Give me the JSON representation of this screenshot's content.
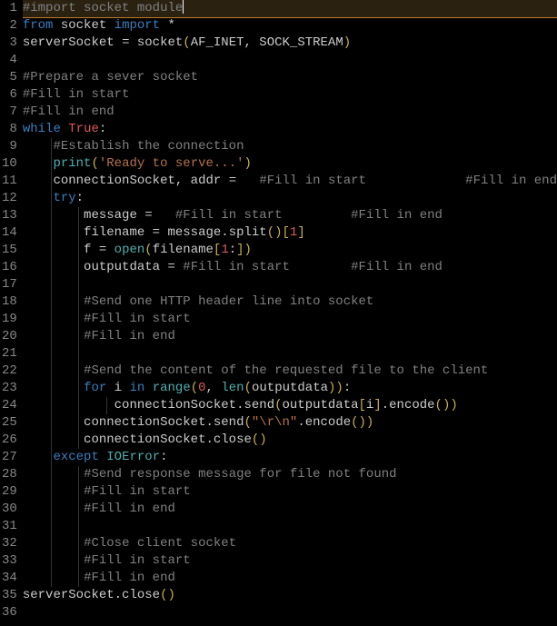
{
  "lines": [
    {
      "n": "1",
      "tokens": [
        {
          "t": "#import socket module",
          "c": "cm"
        }
      ],
      "hl": true,
      "cursor": true
    },
    {
      "n": "2",
      "tokens": [
        {
          "t": "from",
          "c": "kw"
        },
        {
          "t": " socket ",
          "c": "id"
        },
        {
          "t": "import",
          "c": "kw"
        },
        {
          "t": " *",
          "c": "op"
        }
      ]
    },
    {
      "n": "3",
      "tokens": [
        {
          "t": "serverSocket ",
          "c": "id"
        },
        {
          "t": "=",
          "c": "eq"
        },
        {
          "t": " socket",
          "c": "id"
        },
        {
          "t": "(",
          "c": "paren"
        },
        {
          "t": "AF_INET",
          "c": "id"
        },
        {
          "t": ",",
          "c": "punc"
        },
        {
          "t": " SOCK_STREAM",
          "c": "id"
        },
        {
          "t": ")",
          "c": "paren"
        }
      ]
    },
    {
      "n": "4",
      "tokens": []
    },
    {
      "n": "5",
      "tokens": [
        {
          "t": "#Prepare a sever socket",
          "c": "cm"
        }
      ]
    },
    {
      "n": "6",
      "tokens": [
        {
          "t": "#Fill in start",
          "c": "cm"
        }
      ]
    },
    {
      "n": "7",
      "tokens": [
        {
          "t": "#Fill in end",
          "c": "cm"
        }
      ]
    },
    {
      "n": "8",
      "tokens": [
        {
          "t": "while",
          "c": "kw"
        },
        {
          "t": " ",
          "c": "id"
        },
        {
          "t": "True",
          "c": "num"
        },
        {
          "t": ":",
          "c": "punc"
        }
      ]
    },
    {
      "n": "9",
      "tokens": [
        {
          "t": "    ",
          "c": "id"
        },
        {
          "t": "#Establish the connection",
          "c": "cm"
        }
      ]
    },
    {
      "n": "10",
      "tokens": [
        {
          "t": "    ",
          "c": "id"
        },
        {
          "t": "print",
          "c": "builtin"
        },
        {
          "t": "(",
          "c": "paren"
        },
        {
          "t": "'Ready to serve...'",
          "c": "str"
        },
        {
          "t": ")",
          "c": "paren"
        }
      ]
    },
    {
      "n": "11",
      "tokens": [
        {
          "t": "    connectionSocket",
          "c": "id"
        },
        {
          "t": ",",
          "c": "punc"
        },
        {
          "t": " addr ",
          "c": "id"
        },
        {
          "t": "=",
          "c": "eq"
        },
        {
          "t": "   ",
          "c": "id"
        },
        {
          "t": "#Fill in start",
          "c": "cm"
        },
        {
          "t": "             ",
          "c": "id"
        },
        {
          "t": "#Fill in end",
          "c": "cm"
        }
      ]
    },
    {
      "n": "12",
      "tokens": [
        {
          "t": "    ",
          "c": "id"
        },
        {
          "t": "try",
          "c": "kw"
        },
        {
          "t": ":",
          "c": "punc"
        }
      ]
    },
    {
      "n": "13",
      "tokens": [
        {
          "t": "        message ",
          "c": "id"
        },
        {
          "t": "=",
          "c": "eq"
        },
        {
          "t": "   ",
          "c": "id"
        },
        {
          "t": "#Fill in start",
          "c": "cm"
        },
        {
          "t": "         ",
          "c": "id"
        },
        {
          "t": "#Fill in end",
          "c": "cm"
        }
      ]
    },
    {
      "n": "14",
      "tokens": [
        {
          "t": "        filename ",
          "c": "id"
        },
        {
          "t": "=",
          "c": "eq"
        },
        {
          "t": " message.split",
          "c": "id"
        },
        {
          "t": "()[",
          "c": "paren"
        },
        {
          "t": "1",
          "c": "num"
        },
        {
          "t": "]",
          "c": "paren"
        }
      ]
    },
    {
      "n": "15",
      "tokens": [
        {
          "t": "        f ",
          "c": "id"
        },
        {
          "t": "=",
          "c": "eq"
        },
        {
          "t": " ",
          "c": "id"
        },
        {
          "t": "open",
          "c": "builtin"
        },
        {
          "t": "(",
          "c": "paren"
        },
        {
          "t": "filename",
          "c": "id"
        },
        {
          "t": "[",
          "c": "paren"
        },
        {
          "t": "1",
          "c": "num"
        },
        {
          "t": ":",
          "c": "punc"
        },
        {
          "t": "])",
          "c": "paren"
        }
      ]
    },
    {
      "n": "16",
      "tokens": [
        {
          "t": "        outputdata ",
          "c": "id"
        },
        {
          "t": "=",
          "c": "eq"
        },
        {
          "t": " ",
          "c": "id"
        },
        {
          "t": "#Fill in start",
          "c": "cm"
        },
        {
          "t": "        ",
          "c": "id"
        },
        {
          "t": "#Fill in end",
          "c": "cm"
        }
      ]
    },
    {
      "n": "17",
      "tokens": []
    },
    {
      "n": "18",
      "tokens": [
        {
          "t": "        ",
          "c": "id"
        },
        {
          "t": "#Send one HTTP header line into socket",
          "c": "cm"
        }
      ]
    },
    {
      "n": "19",
      "tokens": [
        {
          "t": "        ",
          "c": "id"
        },
        {
          "t": "#Fill in start",
          "c": "cm"
        }
      ]
    },
    {
      "n": "20",
      "tokens": [
        {
          "t": "        ",
          "c": "id"
        },
        {
          "t": "#Fill in end",
          "c": "cm"
        }
      ]
    },
    {
      "n": "21",
      "tokens": []
    },
    {
      "n": "22",
      "tokens": [
        {
          "t": "        ",
          "c": "id"
        },
        {
          "t": "#Send the content of the requested file to the client",
          "c": "cm"
        }
      ]
    },
    {
      "n": "23",
      "tokens": [
        {
          "t": "        ",
          "c": "id"
        },
        {
          "t": "for",
          "c": "kw"
        },
        {
          "t": " i ",
          "c": "id"
        },
        {
          "t": "in",
          "c": "kw"
        },
        {
          "t": " ",
          "c": "id"
        },
        {
          "t": "range",
          "c": "builtin"
        },
        {
          "t": "(",
          "c": "paren"
        },
        {
          "t": "0",
          "c": "num"
        },
        {
          "t": ",",
          "c": "punc"
        },
        {
          "t": " ",
          "c": "id"
        },
        {
          "t": "len",
          "c": "builtin"
        },
        {
          "t": "(",
          "c": "paren"
        },
        {
          "t": "outputdata",
          "c": "id"
        },
        {
          "t": "))",
          "c": "paren"
        },
        {
          "t": ":",
          "c": "punc"
        }
      ]
    },
    {
      "n": "24",
      "tokens": [
        {
          "t": "            connectionSocket.send",
          "c": "id"
        },
        {
          "t": "(",
          "c": "paren"
        },
        {
          "t": "outputdata",
          "c": "id"
        },
        {
          "t": "[",
          "c": "paren"
        },
        {
          "t": "i",
          "c": "id"
        },
        {
          "t": "]",
          "c": "paren"
        },
        {
          "t": ".encode",
          "c": "id"
        },
        {
          "t": "())",
          "c": "paren"
        }
      ]
    },
    {
      "n": "25",
      "tokens": [
        {
          "t": "        connectionSocket.send",
          "c": "id"
        },
        {
          "t": "(",
          "c": "paren"
        },
        {
          "t": "\"\\r\\n\"",
          "c": "str"
        },
        {
          "t": ".encode",
          "c": "id"
        },
        {
          "t": "())",
          "c": "paren"
        }
      ]
    },
    {
      "n": "26",
      "tokens": [
        {
          "t": "        connectionSocket.close",
          "c": "id"
        },
        {
          "t": "()",
          "c": "paren"
        }
      ]
    },
    {
      "n": "27",
      "tokens": [
        {
          "t": "    ",
          "c": "id"
        },
        {
          "t": "except",
          "c": "kw"
        },
        {
          "t": " ",
          "c": "id"
        },
        {
          "t": "IOError",
          "c": "builtin"
        },
        {
          "t": ":",
          "c": "punc"
        }
      ]
    },
    {
      "n": "28",
      "tokens": [
        {
          "t": "        ",
          "c": "id"
        },
        {
          "t": "#Send response message for file not found",
          "c": "cm"
        }
      ]
    },
    {
      "n": "29",
      "tokens": [
        {
          "t": "        ",
          "c": "id"
        },
        {
          "t": "#Fill in start",
          "c": "cm"
        }
      ]
    },
    {
      "n": "30",
      "tokens": [
        {
          "t": "        ",
          "c": "id"
        },
        {
          "t": "#Fill in end",
          "c": "cm"
        }
      ]
    },
    {
      "n": "31",
      "tokens": []
    },
    {
      "n": "32",
      "tokens": [
        {
          "t": "        ",
          "c": "id"
        },
        {
          "t": "#Close client socket",
          "c": "cm"
        }
      ]
    },
    {
      "n": "33",
      "tokens": [
        {
          "t": "        ",
          "c": "id"
        },
        {
          "t": "#Fill in start",
          "c": "cm"
        }
      ]
    },
    {
      "n": "34",
      "tokens": [
        {
          "t": "        ",
          "c": "id"
        },
        {
          "t": "#Fill in end",
          "c": "cm"
        }
      ]
    },
    {
      "n": "35",
      "tokens": [
        {
          "t": "serverSocket.close",
          "c": "id"
        },
        {
          "t": "()",
          "c": "paren"
        }
      ]
    },
    {
      "n": "36",
      "tokens": []
    }
  ],
  "indent_guides": {
    "9": [
      1
    ],
    "10": [
      1
    ],
    "11": [
      1
    ],
    "12": [
      1
    ],
    "13": [
      1,
      2
    ],
    "14": [
      1,
      2
    ],
    "15": [
      1,
      2
    ],
    "16": [
      1,
      2
    ],
    "17": [
      1,
      2
    ],
    "18": [
      1,
      2
    ],
    "19": [
      1,
      2
    ],
    "20": [
      1,
      2
    ],
    "21": [
      1,
      2
    ],
    "22": [
      1,
      2
    ],
    "23": [
      1,
      2
    ],
    "24": [
      1,
      2,
      3
    ],
    "25": [
      1,
      2
    ],
    "26": [
      1,
      2
    ],
    "27": [
      1
    ],
    "28": [
      1,
      2
    ],
    "29": [
      1,
      2
    ],
    "30": [
      1,
      2
    ],
    "31": [
      1,
      2
    ],
    "32": [
      1,
      2
    ],
    "33": [
      1,
      2
    ],
    "34": [
      1,
      2
    ]
  }
}
